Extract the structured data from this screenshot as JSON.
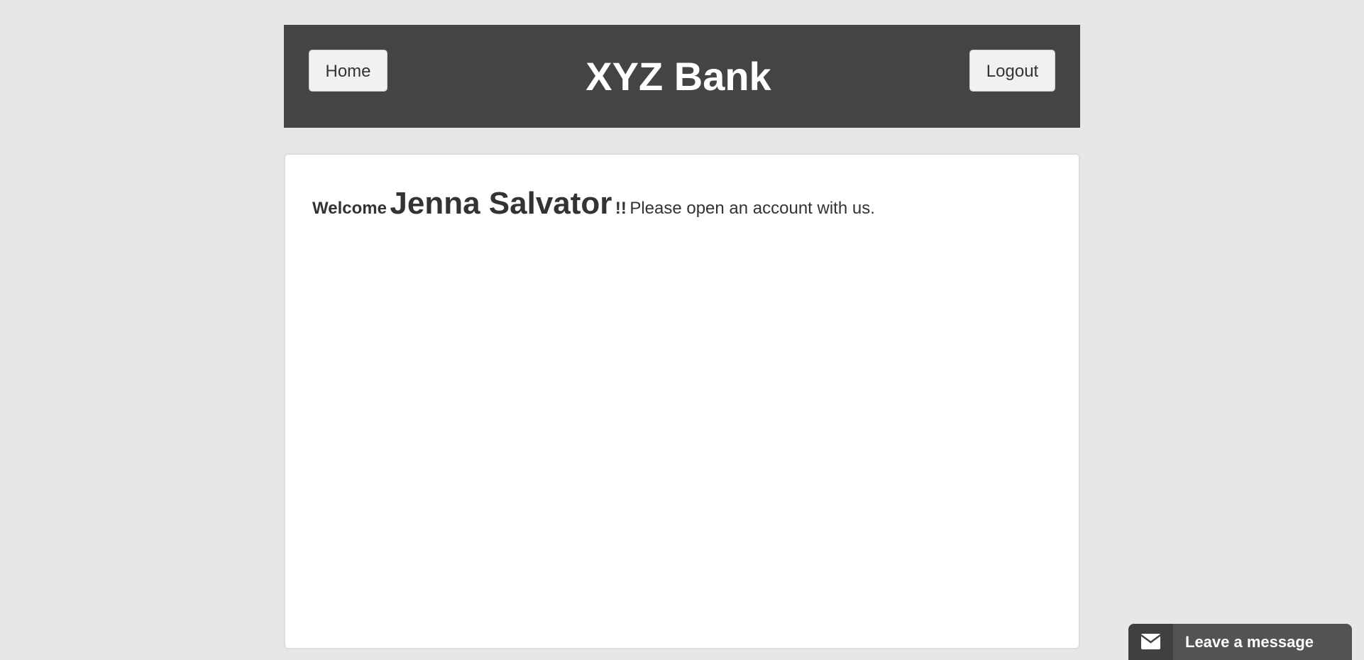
{
  "header": {
    "title": "XYZ Bank",
    "home_label": "Home",
    "logout_label": "Logout"
  },
  "main": {
    "welcome_label": "Welcome",
    "customer_name": "Jenna Salvator",
    "exclaim": "!!",
    "message": "Please open an account with us."
  },
  "chat_widget": {
    "label": "Leave a message",
    "icon": "envelope-icon"
  },
  "colors": {
    "page_background": "#e7e7e7",
    "header_background": "#444444",
    "button_background": "#f1f1f1",
    "widget_background": "#535353"
  }
}
